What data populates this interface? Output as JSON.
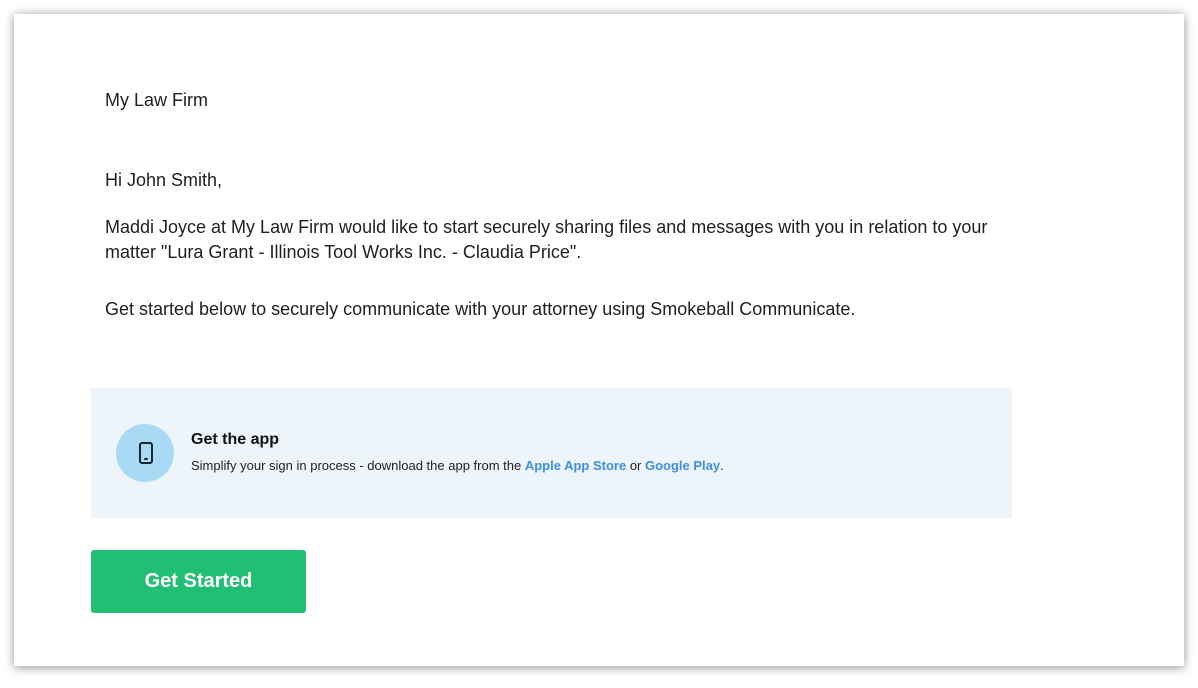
{
  "email": {
    "firm_name": "My Law Firm",
    "greeting": "Hi John Smith,",
    "paragraph_1": "Maddi Joyce at My Law Firm would like to start securely sharing files and messages with you in relation to your matter \"Lura Grant - Illinois Tool Works Inc. - Claudia Price\".",
    "paragraph_2": "Get started below to securely communicate with your attorney using Smokeball Communicate."
  },
  "app_promo": {
    "icon": "mobile-phone-icon",
    "title": "Get the app",
    "description_prefix": "Simplify your sign in process - download the app from the ",
    "apple_link": "Apple App Store",
    "connector": " or ",
    "google_link": "Google Play",
    "description_suffix": "."
  },
  "cta": {
    "label": "Get Started"
  },
  "colors": {
    "button_green": "#21bf73",
    "link_blue": "#3d8fe0",
    "promo_background": "#eef5fa",
    "icon_circle": "#a9daf5"
  }
}
